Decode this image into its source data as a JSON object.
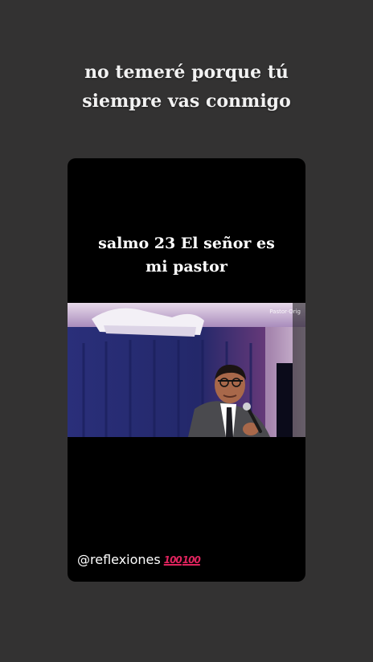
{
  "story": {
    "headline": "no temeré porque tú\nsiempre vas conmigo"
  },
  "video": {
    "caption": "salmo 23 El señor es\nmi pastor",
    "watermark": "Pastor·Orig",
    "handle": "@reflexiones",
    "emoji": [
      "100",
      "100"
    ],
    "emoji_icon": "hundred-points-icon"
  },
  "colors": {
    "background": "#333232",
    "card": "#000000",
    "emoji": "#e0245e"
  }
}
